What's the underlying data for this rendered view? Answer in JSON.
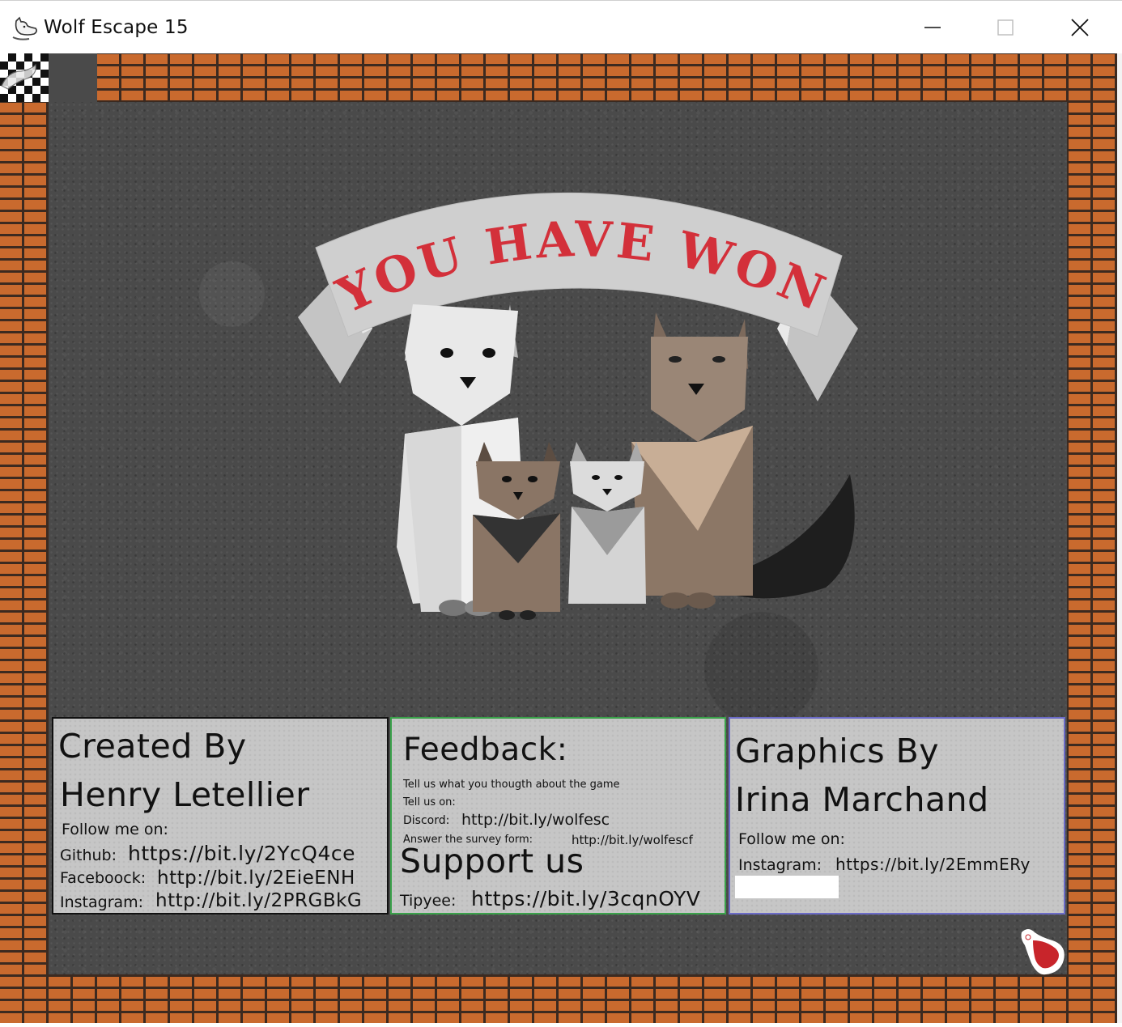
{
  "window": {
    "title": "Wolf Escape 15",
    "icon": "wolf-head-icon",
    "controls": [
      "minimize-icon",
      "maximize-icon",
      "close-icon"
    ]
  },
  "banner": {
    "text": "YOU HAVE WON",
    "text_color": "#d3303a",
    "ribbon_color": "#c9c9c9"
  },
  "colors": {
    "brick": "#c96a2e",
    "mortar": "#3c2a20",
    "floor": "#4a4a4a",
    "panel": "#c6c6c6",
    "created_border": "#111111",
    "feedback_border": "#3aa14a",
    "graphics_border": "#6b6bc7"
  },
  "panels": {
    "created": {
      "heading": "Created By",
      "name": "Henry Letellier",
      "follow": "Follow me on:",
      "github_label": "Github:",
      "github_url": "https://bit.ly/2YcQ4ce",
      "facebook_label": "Faceboock:",
      "facebook_url": "http://bit.ly/2EieENH",
      "instagram_label": "Instagram:",
      "instagram_url": "http://bit.ly/2PRGBkG"
    },
    "feedback": {
      "heading": "Feedback:",
      "line1": "Tell us what you thougth about the game",
      "line2": "Tell us on:",
      "discord_label": "Discord:",
      "discord_url": "http://bit.ly/wolfesc",
      "survey_label": "Answer the survey form:",
      "survey_url": "http://bit.ly/wolfescf",
      "support_heading": "Support us",
      "tipyee_label": "Tipyee:",
      "tipyee_url": "https://bit.ly/3cqnOYV"
    },
    "graphics": {
      "heading": "Graphics By",
      "name": "Irina Marchand",
      "follow": "Follow me on:",
      "instagram_label": "Instagram:",
      "instagram_url": "https://bit.ly/2EmmERy"
    }
  },
  "items": {
    "corner": "checkered-flag-icon",
    "pickup": "steak-icon"
  }
}
